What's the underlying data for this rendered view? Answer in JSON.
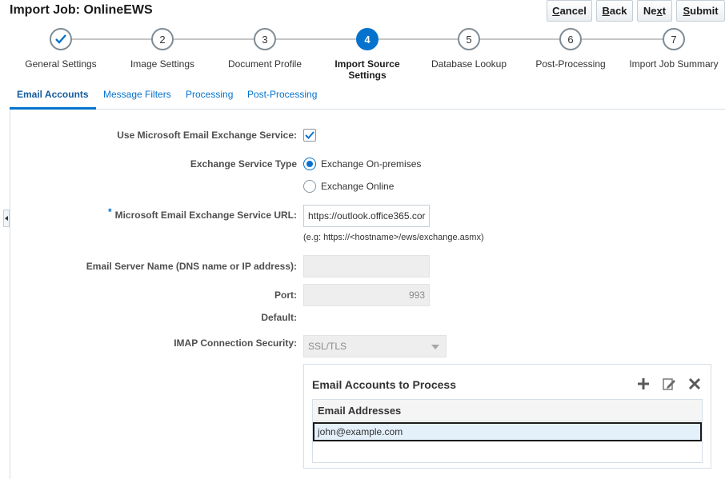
{
  "page": {
    "title": "Import Job: OnlineEWS"
  },
  "buttons": {
    "cancel": {
      "mnemonic": "C",
      "rest": "ancel"
    },
    "back": {
      "mnemonic": "B",
      "rest": "ack"
    },
    "next": {
      "pre": "Ne",
      "mnemonic": "x",
      "rest": "t"
    },
    "submit": {
      "mnemonic": "S",
      "rest": "ubmit"
    }
  },
  "train": {
    "current_step": 4,
    "steps": [
      {
        "num": "1",
        "label": "General Settings",
        "state": "done"
      },
      {
        "num": "2",
        "label": "Image Settings",
        "state": "pending"
      },
      {
        "num": "3",
        "label": "Document Profile",
        "state": "pending"
      },
      {
        "num": "4",
        "label": "Import Source Settings",
        "state": "current"
      },
      {
        "num": "5",
        "label": "Database Lookup",
        "state": "pending"
      },
      {
        "num": "6",
        "label": "Post-Processing",
        "state": "pending"
      },
      {
        "num": "7",
        "label": "Import Job Summary",
        "state": "pending"
      }
    ]
  },
  "tabs": [
    {
      "label": "Email Accounts",
      "active": true
    },
    {
      "label": "Message Filters",
      "active": false
    },
    {
      "label": "Processing",
      "active": false
    },
    {
      "label": "Post-Processing",
      "active": false
    }
  ],
  "form": {
    "use_exchange": {
      "label": "Use Microsoft Email Exchange Service:",
      "checked": true
    },
    "service_type": {
      "label": "Exchange Service Type",
      "options": [
        {
          "label": "Exchange On-premises",
          "selected": true
        },
        {
          "label": "Exchange Online",
          "selected": false
        }
      ]
    },
    "url": {
      "required_marker": "*",
      "label": "Microsoft Email Exchange Service URL:",
      "value": "https://outlook.office365.cor",
      "hint": "(e.g: https://<hostname>/ews/exchange.asmx)"
    },
    "server_name": {
      "label": "Email Server Name (DNS name or IP address):",
      "value": ""
    },
    "port": {
      "label": "Port:",
      "value": "993"
    },
    "default": {
      "label": "Default:"
    },
    "imap_security": {
      "label": "IMAP Connection Security:",
      "value": "SSL/TLS"
    }
  },
  "accounts": {
    "title": "Email Accounts to Process",
    "tools": [
      "add-icon",
      "edit-icon",
      "delete-icon"
    ],
    "column": "Email Addresses",
    "rows": [
      "john@example.com"
    ]
  },
  "colors": {
    "accent": "#0572ce",
    "tab_active": "#145c9e"
  }
}
